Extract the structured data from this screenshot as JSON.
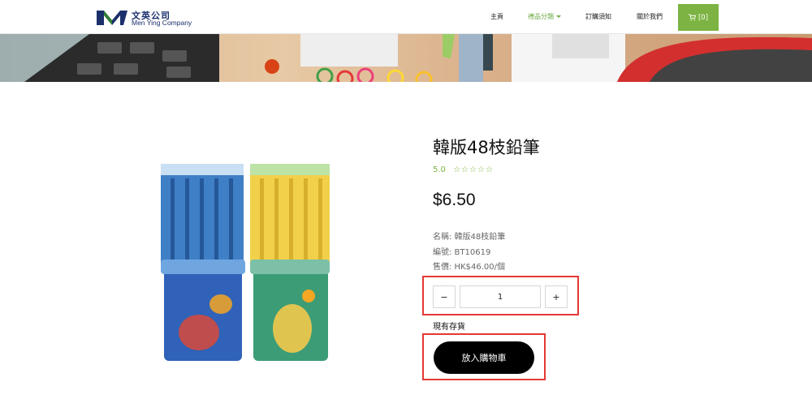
{
  "header": {
    "logo_cn": "文英公司",
    "logo_en": "Men Ying Company",
    "nav": [
      {
        "label": "主頁",
        "active": false
      },
      {
        "label": "禮品分類",
        "active": true,
        "has_dropdown": true
      },
      {
        "label": "訂購須知",
        "active": false
      },
      {
        "label": "關於我們",
        "active": false
      }
    ],
    "cart_label": "[0]"
  },
  "product": {
    "title": "韓版48枝鉛筆",
    "rating_value": "5.0",
    "stars": "☆☆☆☆☆",
    "price": "$6.50",
    "name_line": "名稱: 韓版48枝鉛筆",
    "code_line": "編號: BT10619",
    "retail_line": "售價: HK$46.00/個",
    "quantity": {
      "minus": "−",
      "value": "1",
      "plus": "+"
    },
    "stock_label": "現有存貨",
    "add_to_cart_label": "放入購物車"
  },
  "colors": {
    "accent_green": "#7cb342",
    "highlight_red": "#e53935",
    "logo_blue": "#1b2f6b"
  }
}
